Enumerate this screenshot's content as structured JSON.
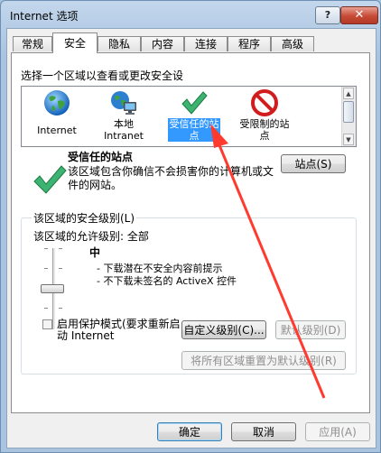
{
  "window": {
    "title": "Internet 选项",
    "help_label": "?",
    "close_label": "✕"
  },
  "tabs": [
    {
      "label": "常规"
    },
    {
      "label": "安全"
    },
    {
      "label": "隐私"
    },
    {
      "label": "内容"
    },
    {
      "label": "连接"
    },
    {
      "label": "程序"
    },
    {
      "label": "高级"
    }
  ],
  "security": {
    "zone_prompt": "选择一个区域以查看或更改安全设",
    "zones": [
      {
        "label": "Internet",
        "icon": "globe-icon"
      },
      {
        "label": "本地\nIntranet",
        "icon": "intranet-icon"
      },
      {
        "label": "受信任的站\n点",
        "icon": "checkmark-icon",
        "selected": true
      },
      {
        "label": "受限制的站\n点",
        "icon": "restricted-icon"
      }
    ],
    "scroll_up": "▲",
    "scroll_down": "▼",
    "selected_zone_title": "受信任的站点",
    "selected_zone_desc": "该区域包含你确信不会损害你的计算机或文件的网站。",
    "sites_button": "站点(S)",
    "group_label": "该区域的安全级别(L)",
    "allowed_level": "该区域的允许级别: 全部",
    "level_name": "中",
    "level_desc": [
      "- 下载潜在不安全内容前提示",
      "- 不下载未签名的 ActiveX 控件"
    ],
    "protected_mode": "启用保护模式(要求重新启动 Internet",
    "custom_level_button": "自定义级别(C)...",
    "default_level_button": "默认级别(D)",
    "reset_all_button": "将所有区域重置为默认级别(R)"
  },
  "footer": {
    "ok": "确定",
    "cancel": "取消",
    "apply": "应用(A)"
  },
  "colors": {
    "selection": "#3399ff",
    "annotation_arrow": "#ff3b30"
  }
}
